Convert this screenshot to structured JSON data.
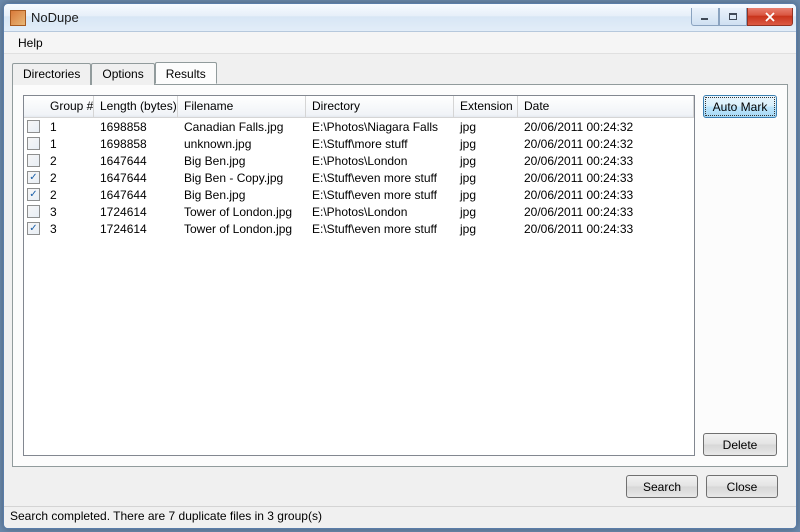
{
  "window": {
    "title": "NoDupe"
  },
  "menu": {
    "help": "Help"
  },
  "tabs": {
    "directories": "Directories",
    "options": "Options",
    "results": "Results"
  },
  "columns": {
    "group": "Group #",
    "length": "Length (bytes)",
    "filename": "Filename",
    "directory": "Directory",
    "extension": "Extension",
    "date": "Date"
  },
  "rows": [
    {
      "checked": false,
      "group": "1",
      "length": "1698858",
      "filename": "Canadian Falls.jpg",
      "directory": "E:\\Photos\\Niagara Falls",
      "extension": "jpg",
      "date": "20/06/2011 00:24:32"
    },
    {
      "checked": false,
      "group": "1",
      "length": "1698858",
      "filename": "unknown.jpg",
      "directory": "E:\\Stuff\\more stuff",
      "extension": "jpg",
      "date": "20/06/2011 00:24:32"
    },
    {
      "checked": false,
      "group": "2",
      "length": "1647644",
      "filename": "Big Ben.jpg",
      "directory": "E:\\Photos\\London",
      "extension": "jpg",
      "date": "20/06/2011 00:24:33"
    },
    {
      "checked": true,
      "group": "2",
      "length": "1647644",
      "filename": "Big Ben - Copy.jpg",
      "directory": "E:\\Stuff\\even more stuff",
      "extension": "jpg",
      "date": "20/06/2011 00:24:33"
    },
    {
      "checked": true,
      "group": "2",
      "length": "1647644",
      "filename": "Big Ben.jpg",
      "directory": "E:\\Stuff\\even more stuff",
      "extension": "jpg",
      "date": "20/06/2011 00:24:33"
    },
    {
      "checked": false,
      "group": "3",
      "length": "1724614",
      "filename": "Tower of London.jpg",
      "directory": "E:\\Photos\\London",
      "extension": "jpg",
      "date": "20/06/2011 00:24:33"
    },
    {
      "checked": true,
      "group": "3",
      "length": "1724614",
      "filename": "Tower of London.jpg",
      "directory": "E:\\Stuff\\even more stuff",
      "extension": "jpg",
      "date": "20/06/2011 00:24:33"
    }
  ],
  "buttons": {
    "auto_mark": "Auto Mark",
    "delete": "Delete",
    "search": "Search",
    "close": "Close"
  },
  "status": "Search completed. There are 7 duplicate files in 3 group(s)"
}
